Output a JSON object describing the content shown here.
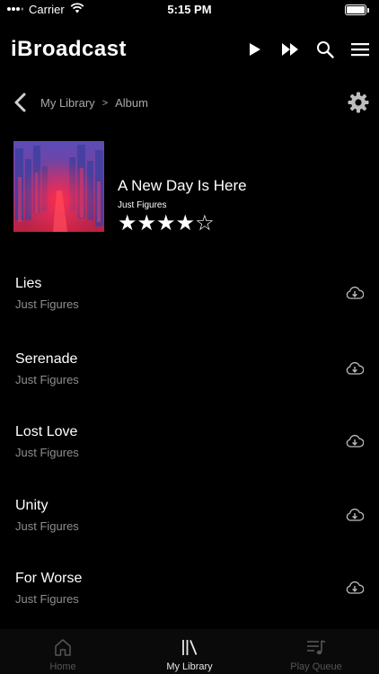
{
  "status_bar": {
    "carrier": "Carrier",
    "time": "5:15 PM"
  },
  "header": {
    "logo": "iBroadcast"
  },
  "breadcrumb": {
    "items": [
      "My Library",
      "Album"
    ],
    "separator": ">"
  },
  "album": {
    "title": "A New Day Is Here",
    "artist": "Just Figures",
    "rating": 4,
    "rating_max": 5,
    "stars": [
      "★",
      "★",
      "★",
      "★",
      "☆"
    ]
  },
  "tracks": [
    {
      "title": "Lies",
      "artist": "Just Figures"
    },
    {
      "title": "Serenade",
      "artist": "Just Figures"
    },
    {
      "title": "Lost Love",
      "artist": "Just Figures"
    },
    {
      "title": "Unity",
      "artist": "Just Figures"
    },
    {
      "title": "For Worse",
      "artist": "Just Figures"
    }
  ],
  "tab_bar": {
    "tabs": [
      {
        "label": "Home",
        "icon": "home-icon",
        "active": false
      },
      {
        "label": "My Library",
        "icon": "library-icon",
        "active": true
      },
      {
        "label": "Play Queue",
        "icon": "play-queue-icon",
        "active": false
      }
    ]
  },
  "colors": {
    "background": "#000000",
    "text": "#ffffff",
    "muted_text": "#8e8e8e",
    "inactive_tab": "#555555"
  }
}
